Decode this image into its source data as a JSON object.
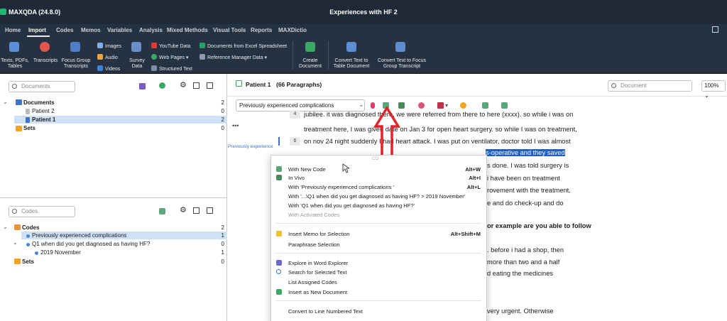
{
  "window": {
    "app_name": "MAXQDA (24.8.0)",
    "title": "Experiences with HF 2"
  },
  "menu": [
    "Home",
    "Import",
    "Codes",
    "Memos",
    "Variables",
    "Analysis",
    "Mixed Methods",
    "Visual Tools",
    "Reports",
    "MAXDictio"
  ],
  "ribbon": {
    "texts_pdfs_tables": "Texts, PDFs,\nTables",
    "transcripts": "Transcripts",
    "focus_group": "Focus Group\nTranscripts",
    "images": "Images",
    "audio": "Audio",
    "videos": "Videos",
    "survey_data": "Survey\nData",
    "youtube": "YouTube Data",
    "web_pages": "Web Pages",
    "structured_text": "Structured Text",
    "excel": "Documents from Excel Spreadsheet",
    "reference": "Reference Manager Data",
    "create_document": "Create\nDocument",
    "convert_table": "Convert Text to\nTable Document",
    "convert_focus": "Convert Text to Focus\nGroup Transcript"
  },
  "documents_panel": {
    "search_placeholder": "Documents",
    "items": [
      {
        "label": "Documents",
        "count": "2"
      },
      {
        "label": "Patient 2",
        "count": "0"
      },
      {
        "label": "Patient 1",
        "count": "2"
      },
      {
        "label": "Sets",
        "count": "0"
      }
    ]
  },
  "codes_panel": {
    "search_placeholder": "Codes",
    "items": [
      {
        "label": "Codes",
        "count": "2"
      },
      {
        "label": "Previously experienced complications",
        "count": "1"
      },
      {
        "label": "Q1 when did you get diagnosed as having HF?",
        "count": "0"
      },
      {
        "label": "2019 November",
        "count": "1"
      },
      {
        "label": "Sets",
        "count": "0"
      }
    ]
  },
  "document_view": {
    "title": "Patient 1",
    "paragraphs": "(66 Paragraphs)",
    "search_placeholder": "Document",
    "zoom": "100%",
    "code_dropdown": "Previously experienced complications",
    "margin_code": "Previously experience",
    "lines": [
      {
        "num": "4",
        "text": "jubilee. it was diagnosed there, we were referred from there to here (xxxx). so while i was on"
      },
      {
        "num": "",
        "text": "treatment here, I was given date on Jan 3 for open heart surgery. so while I was on treatment,"
      },
      {
        "num": "6",
        "text": "on nov 24 night suddenly I had heart attack. I was put on ventilator, doctor told I was almost"
      },
      {
        "num": "",
        "text": "s-operative and they saved"
      },
      {
        "num": "",
        "text": "s done. I was told surgery is"
      },
      {
        "num": "",
        "text": "i have been on treatment"
      },
      {
        "num": "",
        "text": "rovement with the treatment."
      },
      {
        "num": "",
        "text": "e and do check-up and do"
      },
      {
        "num": "",
        "text": "or example are you able to follow"
      },
      {
        "num": "",
        "text": ". before i had a shop, then"
      },
      {
        "num": "",
        "text": "more than two and a half"
      },
      {
        "num": "",
        "text": "d eating the medicines"
      },
      {
        "num": "",
        "text": "very urgent. Otherwise"
      }
    ]
  },
  "context_menu": {
    "header": "CO",
    "items": [
      {
        "label": "With New Code",
        "shortcut": "Alt+W"
      },
      {
        "label": "In Vivo",
        "shortcut": "Alt+I"
      },
      {
        "label": "With 'Previously experienced complications '",
        "shortcut": "Alt+L"
      },
      {
        "label": "With '...\\Q1 when did you get diagnosed as having HF? > 2019 November'",
        "shortcut": ""
      },
      {
        "label": "With 'Q1 when did you get diagnosed as having HF?'",
        "shortcut": ""
      },
      {
        "label": "With Activated Codes",
        "shortcut": ""
      },
      {
        "label": "Insert Memo for Selection",
        "shortcut": "Alt+Shift+M"
      },
      {
        "label": "Paraphrase Selection",
        "shortcut": ""
      },
      {
        "label": "Explore in Word Explorer",
        "shortcut": ""
      },
      {
        "label": "Search for Selected Text",
        "shortcut": ""
      },
      {
        "label": "List Assigned Codes",
        "shortcut": ""
      },
      {
        "label": "Insert as New Document",
        "shortcut": ""
      },
      {
        "label": "Convert to Line Numbered Text",
        "shortcut": ""
      }
    ]
  },
  "colors": {
    "accent": "#1f5fbf",
    "annotation_arrow": "#e0242b",
    "ribbon_bg": "#263241"
  }
}
